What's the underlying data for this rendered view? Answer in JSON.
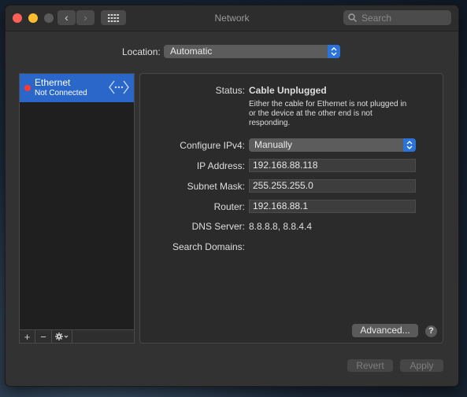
{
  "window": {
    "title": "Network",
    "search_placeholder": "Search",
    "nav_back_glyph": "‹",
    "nav_forward_glyph": "›"
  },
  "location": {
    "label": "Location:",
    "value": "Automatic"
  },
  "services": [
    {
      "name": "Ethernet",
      "status": "Not Connected",
      "status_color": "#fe3b30",
      "icon": "ethernet-arrows-icon"
    }
  ],
  "sidebar_tools": {
    "add": "+",
    "remove": "−"
  },
  "detail": {
    "status_label": "Status:",
    "status_value": "Cable Unplugged",
    "status_desc": [
      "Either the cable for Ethernet is not plugged in",
      "or the device at the other end is not",
      "responding."
    ],
    "configure_label": "Configure IPv4:",
    "configure_value": "Manually",
    "ip_label": "IP Address:",
    "ip_value": "192.168.88.118",
    "subnet_label": "Subnet Mask:",
    "subnet_value": "255.255.255.0",
    "router_label": "Router:",
    "router_value": "192.168.88.1",
    "dns_label": "DNS Server:",
    "dns_value": "8.8.8.8, 8.8.4.4",
    "search_domains_label": "Search Domains:",
    "advanced_button": "Advanced...",
    "help_glyph": "?"
  },
  "footer": {
    "revert": "Revert",
    "apply": "Apply"
  },
  "colors": {
    "accent": "#2a67c9",
    "stepper": "#2a73d9",
    "close": "#fe5f57",
    "minimize": "#febc2e"
  }
}
